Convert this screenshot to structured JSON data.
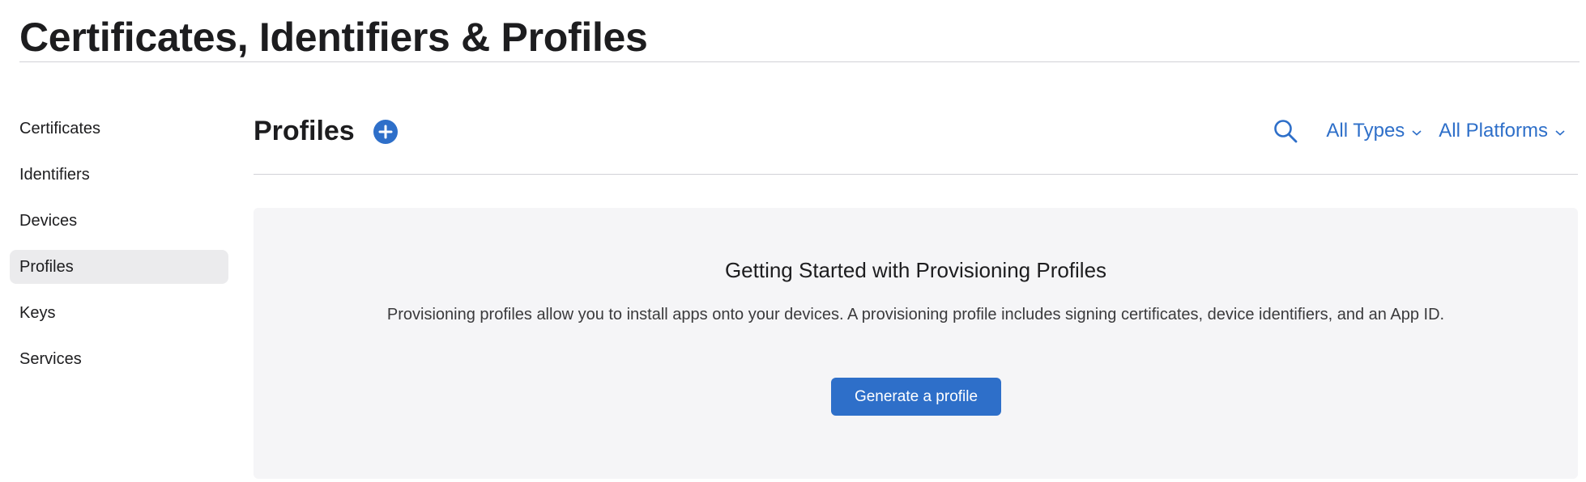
{
  "page": {
    "title": "Certificates, Identifiers & Profiles"
  },
  "sidebar": {
    "items": [
      {
        "label": "Certificates"
      },
      {
        "label": "Identifiers"
      },
      {
        "label": "Devices"
      },
      {
        "label": "Profiles",
        "active": true
      },
      {
        "label": "Keys"
      },
      {
        "label": "Services"
      }
    ]
  },
  "main": {
    "title": "Profiles",
    "add_icon": "plus-circle-icon",
    "search_icon": "search-icon",
    "filters": {
      "types": "All Types",
      "platforms": "All Platforms",
      "chevron_icon": "chevron-down-icon"
    },
    "empty_state": {
      "title": "Getting Started with Provisioning Profiles",
      "description": "Provisioning profiles allow you to install apps onto your devices. A provisioning profile includes signing certificates, device identifiers, and an App ID.",
      "button_label": "Generate a profile"
    }
  },
  "colors": {
    "accent": "#2e6fc9",
    "panel_background": "#f5f5f7",
    "active_item_background": "#ebebed",
    "text": "#1d1d1f"
  }
}
